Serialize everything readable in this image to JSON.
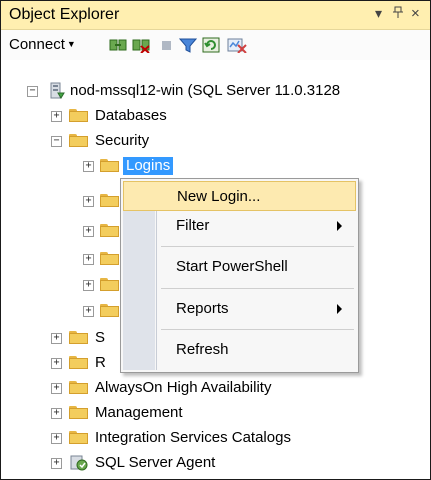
{
  "panel": {
    "title": "Object Explorer",
    "pin_glyph": "▾",
    "dock_glyph": "F",
    "close_glyph": "×"
  },
  "toolbar": {
    "connect_label": "Connect",
    "caret": "▾"
  },
  "tree": {
    "server": "nod-mssql12-win (SQL Server 11.0.3128",
    "databases": "Databases",
    "security": "Security",
    "logins": "Logins",
    "server_objects_partial": "S",
    "replication_partial": "R",
    "alwayson": "AlwaysOn High Availability",
    "management": "Management",
    "integration": "Integration Services Catalogs",
    "agent": "SQL Server Agent"
  },
  "context_menu": {
    "new_login": "New Login...",
    "filter": "Filter",
    "start_powershell": "Start PowerShell",
    "reports": "Reports",
    "refresh": "Refresh"
  },
  "colors": {
    "title_bg": "#ffefb0",
    "selection": "#3399ff",
    "menu_highlight": "#fdeab0",
    "folder": "#f3cd5d"
  }
}
